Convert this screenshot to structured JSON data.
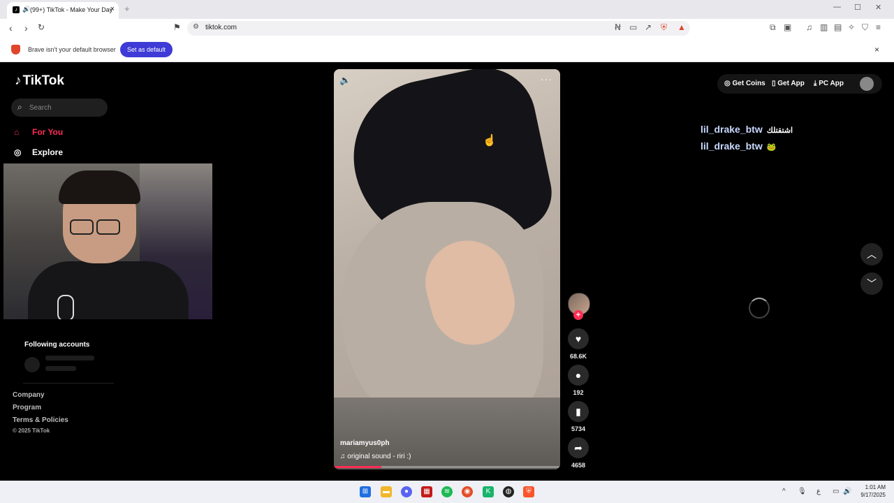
{
  "browser": {
    "tab_title": "(99+) TikTok - Make Your Day",
    "tab_close": "×",
    "new_tab": "+",
    "url": "tiktok.com",
    "infobar": {
      "message": "Brave isn't your default browser",
      "button": "Set as default",
      "close": "×"
    }
  },
  "sidebar": {
    "logo": "TikTok",
    "search_placeholder": "Search",
    "nav": [
      {
        "label": "For You",
        "icon": "home-icon"
      },
      {
        "label": "Explore",
        "icon": "compass-icon"
      }
    ],
    "following_title": "Following accounts",
    "footer": [
      "Company",
      "Program",
      "Terms & Policies"
    ],
    "copyright": "© 2025 TikTok"
  },
  "video": {
    "author": "mariamyus0ph",
    "sound": "original sound - riri :)",
    "progress_fraction": 0.21,
    "actions": {
      "likes": "68.6K",
      "comments": "192",
      "saves": "5734",
      "shares": "4658"
    }
  },
  "topbar": {
    "coins": "Get Coins",
    "app": "Get App",
    "pc": "PC App"
  },
  "comments_overlay": [
    {
      "user": "lil_drake_btw",
      "text": "اشتقتلك"
    },
    {
      "user": "lil_drake_btw",
      "text": "🐸"
    }
  ],
  "taskbar": {
    "time": "1:01 AM",
    "date": "9/17/2025",
    "lang": "ع"
  }
}
